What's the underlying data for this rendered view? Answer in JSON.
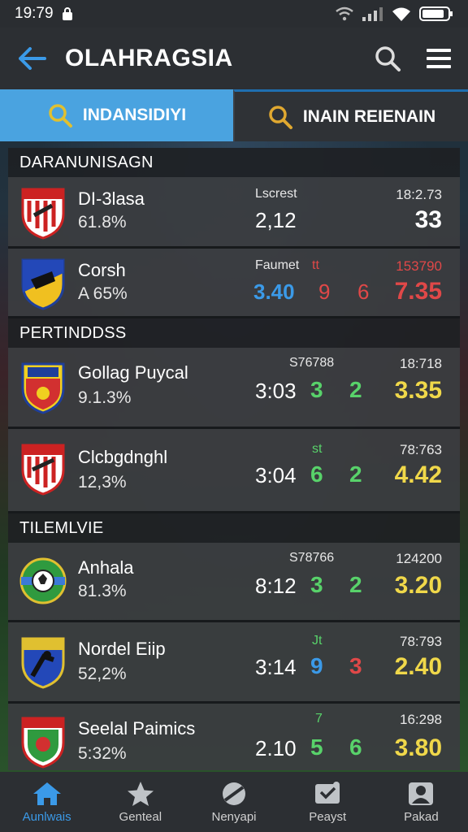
{
  "status": {
    "time": "19:79"
  },
  "header": {
    "title": "OLAHRAGSIA"
  },
  "tabs": [
    {
      "label": "INDANSIDIYI",
      "active": true
    },
    {
      "label": "INAIN REIENAIN",
      "active": false
    }
  ],
  "sections": [
    {
      "title": "DARANUNISAGN",
      "rows": [
        {
          "name": "DI-3lasa",
          "pct": "61.8%",
          "col_label": "Lscrest",
          "score": "2,12",
          "right_label": "18:2.73",
          "value": "33",
          "crest": "red-white-shield"
        },
        {
          "name": "Corsh",
          "pct": "A 65%",
          "col_label": "Faumet",
          "score": "3.40",
          "mid_label": "tt",
          "n1": "9",
          "n2": "6",
          "right_label": "153790",
          "value": "7.35",
          "crest": "blue-yellow-shield"
        }
      ]
    },
    {
      "title": "PERTINDDSS",
      "rows": [
        {
          "name": "Gollag Puycal",
          "pct": "9.1.3%",
          "col_label": "S76788",
          "time": "3:03",
          "n1": "3",
          "n2": "2",
          "right_label": "18:718",
          "value": "3.35",
          "crest": "yellow-red-shield"
        },
        {
          "name": "Clcbgdnghl",
          "pct": "12,3%",
          "mid_label": "st",
          "time": "3:04",
          "n1": "6",
          "n2": "2",
          "right_label": "78:763",
          "value": "4.42",
          "crest": "red-white-shield"
        }
      ]
    },
    {
      "title": "TILEMLVIE",
      "rows": [
        {
          "name": "Anhala",
          "pct": "81.3%",
          "col_label": "S78766",
          "time": "8:12",
          "n1": "3",
          "n2": "2",
          "right_label": "124200",
          "value": "3.20",
          "crest": "ball-round-badge"
        },
        {
          "name": "Nordel Eiip",
          "pct": "52,2%",
          "mid_label": "Jt",
          "time": "3:14",
          "n1": "9",
          "n2": "3",
          "right_label": "78:793",
          "value": "2.40",
          "crest": "blue-red-shield"
        },
        {
          "name": "Seelal Paimics",
          "pct": "5:32%",
          "mid_label": "7",
          "time": "2.10",
          "n1": "5",
          "n2": "6",
          "right_label": "16:298",
          "value": "3.80",
          "crest": "green-red-shield"
        }
      ]
    }
  ],
  "nav": [
    {
      "label": "Aunlwais",
      "icon": "home-icon"
    },
    {
      "label": "Genteal",
      "icon": "star-icon"
    },
    {
      "label": "Nenyapi",
      "icon": "ball-icon"
    },
    {
      "label": "Peayst",
      "icon": "ticket-icon"
    },
    {
      "label": "Pakad",
      "icon": "profile-icon"
    }
  ],
  "colors": {
    "accent": "#4aa3e0",
    "bar": "#2c2f33",
    "blue": "#3b9ae8",
    "red": "#e04848",
    "green": "#58d26a",
    "yellow": "#f0d84a"
  }
}
